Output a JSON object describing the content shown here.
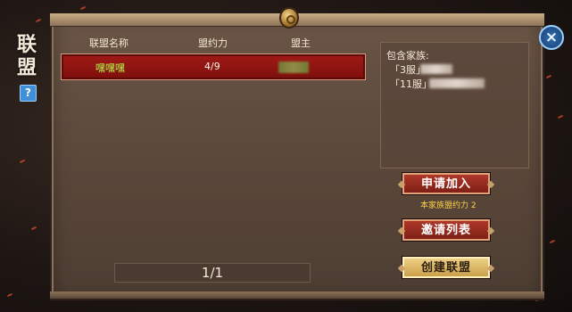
{
  "side_title": [
    "联",
    "盟"
  ],
  "help_label": "?",
  "table": {
    "headers": [
      "联盟名称",
      "盟约力",
      "盟主"
    ],
    "rows": [
      {
        "name": "嘿嘿嘿",
        "power": "4/9"
      }
    ]
  },
  "pager": "1/1",
  "info": {
    "title": "包含家族:",
    "lines": [
      "「3服」",
      "「11服」"
    ]
  },
  "buttons": {
    "apply": "申请加入",
    "apply_note": "本家族盟约力 2",
    "invite_list": "邀请列表",
    "create": "创建联盟"
  },
  "close_icon": "×"
}
